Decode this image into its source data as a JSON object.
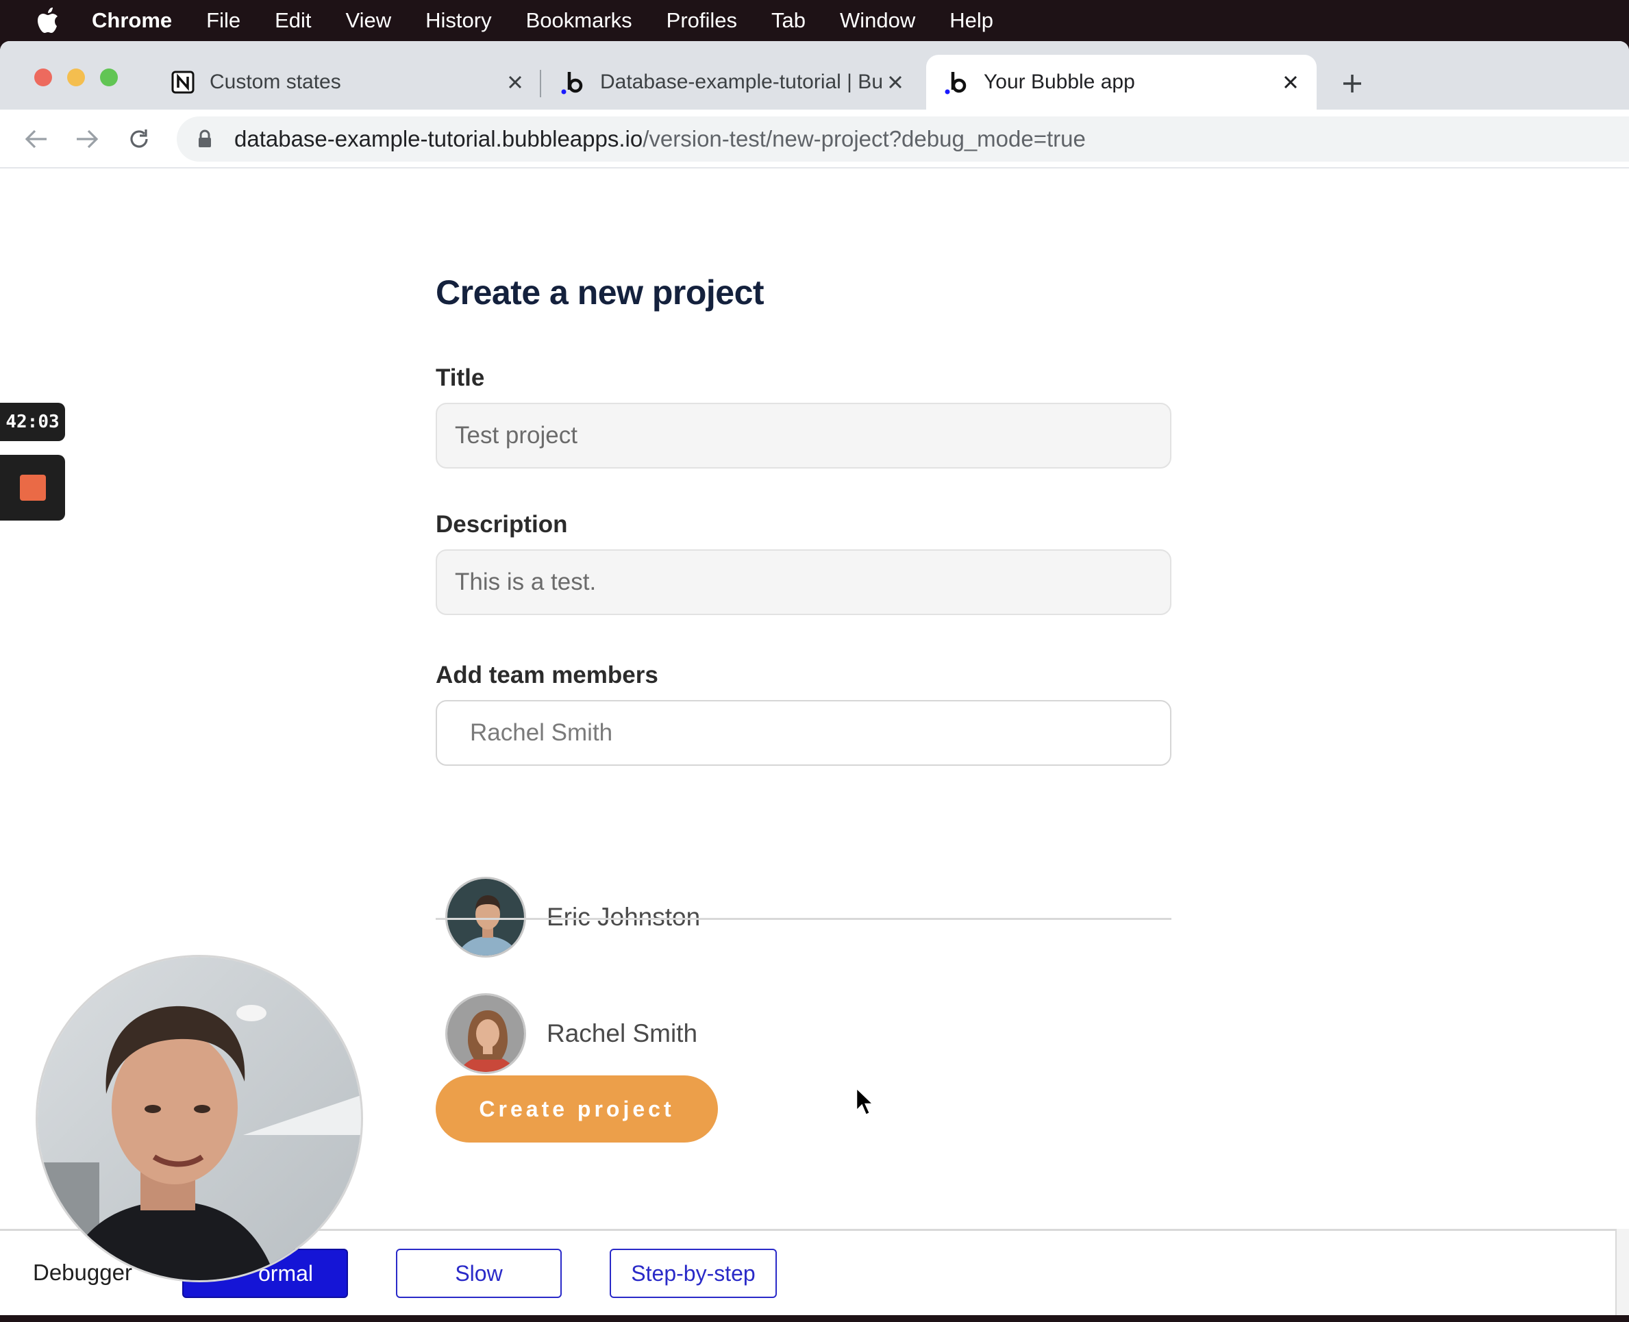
{
  "menubar": {
    "app_name": "Chrome",
    "items": [
      "File",
      "Edit",
      "View",
      "History",
      "Bookmarks",
      "Profiles",
      "Tab",
      "Window",
      "Help"
    ]
  },
  "tabs": [
    {
      "title": "Custom states",
      "icon": "notion-icon"
    },
    {
      "title": "Database-example-tutorial | Bu",
      "icon": "bubble-icon"
    },
    {
      "title": "Your Bubble app",
      "icon": "bubble-icon",
      "active": true
    }
  ],
  "address_bar": {
    "host": "database-example-tutorial.bubbleapps.io",
    "path": "/version-test/new-project?debug_mode=true"
  },
  "form": {
    "heading": "Create a new project",
    "title_label": "Title",
    "title_value": "Test project",
    "description_label": "Description",
    "description_value": "This is a test.",
    "team_label": "Add team members",
    "team_search_value": "Rachel Smith",
    "members": [
      {
        "name": "Eric Johnston"
      },
      {
        "name": "Rachel Smith"
      }
    ],
    "submit_label": "Create project"
  },
  "recording": {
    "timer": "42:03"
  },
  "debugger": {
    "label": "Debugger",
    "normal_label": "ormal",
    "slow_label": "Slow",
    "step_label": "Step-by-step"
  },
  "colors": {
    "heading": "#14213d",
    "button": "#ec9f4a",
    "debugger_active": "#1515d6",
    "record_stop": "#ea6a46"
  }
}
